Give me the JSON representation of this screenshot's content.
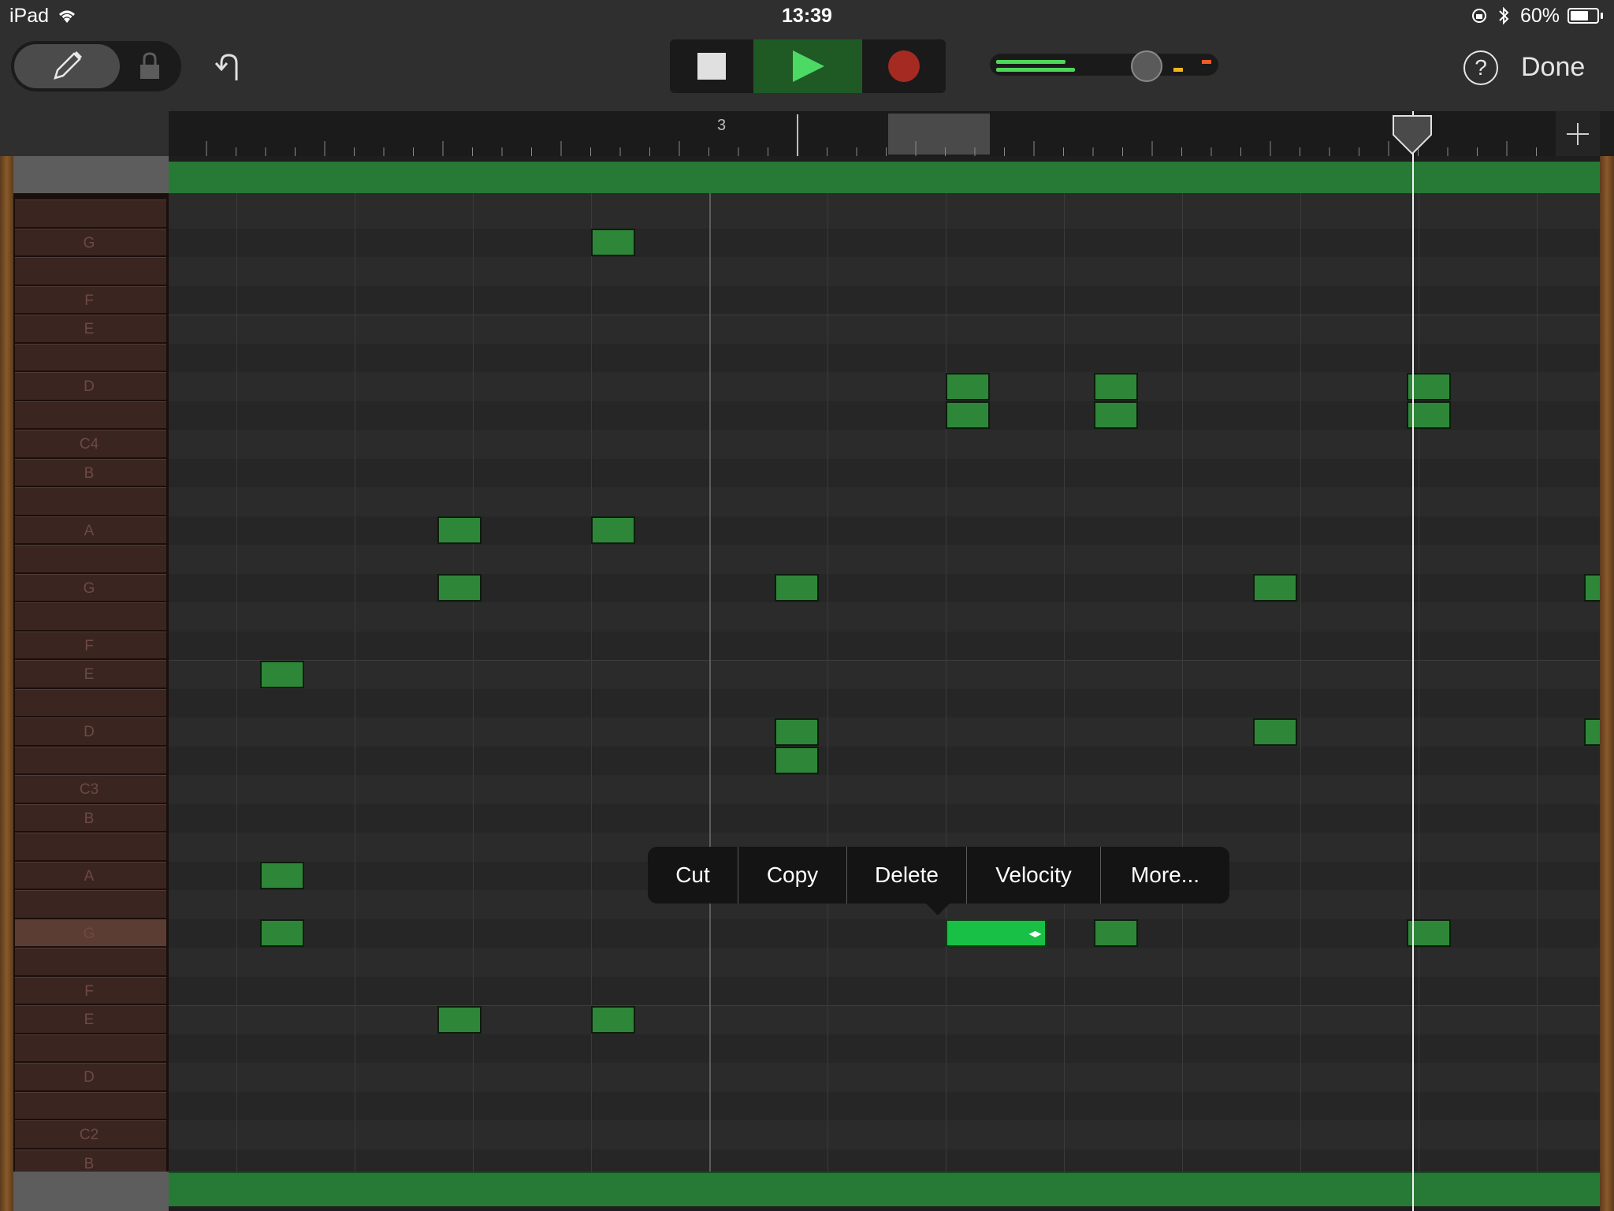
{
  "status_bar": {
    "carrier": "iPad",
    "time": "13:39",
    "battery": "60%"
  },
  "toolbar": {
    "pencil_icon": "pencil-icon",
    "lock_icon": "lock-icon",
    "undo_icon": "undo-icon",
    "stop_icon": "stop-icon",
    "play_icon": "play-icon",
    "record_icon": "record-icon",
    "help_label": "?",
    "done_label": "Done"
  },
  "ruler": {
    "bar_label": "3",
    "add_icon": "plus-icon"
  },
  "keyboard": {
    "labels": [
      {
        "text": "G",
        "row": 1
      },
      {
        "text": "F",
        "row": 3
      },
      {
        "text": "E",
        "row": 4
      },
      {
        "text": "D",
        "row": 6
      },
      {
        "text": "C4",
        "row": 8
      },
      {
        "text": "B",
        "row": 9
      },
      {
        "text": "A",
        "row": 11
      },
      {
        "text": "G",
        "row": 13
      },
      {
        "text": "F",
        "row": 15
      },
      {
        "text": "E",
        "row": 16
      },
      {
        "text": "D",
        "row": 18
      },
      {
        "text": "C3",
        "row": 20
      },
      {
        "text": "B",
        "row": 21
      },
      {
        "text": "A",
        "row": 23
      },
      {
        "text": "G",
        "row": 25
      },
      {
        "text": "F",
        "row": 27
      },
      {
        "text": "E",
        "row": 28
      },
      {
        "text": "D",
        "row": 30
      },
      {
        "text": "C2",
        "row": 32
      },
      {
        "text": "B",
        "row": 33
      }
    ],
    "pressed_row": 25
  },
  "notes": [
    {
      "row": 1,
      "step": 3.0,
      "length": 0.75
    },
    {
      "row": 6,
      "step": 6.0,
      "length": 0.75
    },
    {
      "row": 6,
      "step": 7.25,
      "length": 0.75
    },
    {
      "row": 6,
      "step": 9.9,
      "length": 0.75
    },
    {
      "row": 7,
      "step": 6.0,
      "length": 0.75
    },
    {
      "row": 7,
      "step": 7.25,
      "length": 0.75
    },
    {
      "row": 7,
      "step": 9.9,
      "length": 0.75
    },
    {
      "row": 11,
      "step": 1.7,
      "length": 0.75
    },
    {
      "row": 11,
      "step": 3.0,
      "length": 0.75
    },
    {
      "row": 13,
      "step": 1.7,
      "length": 0.75
    },
    {
      "row": 13,
      "step": 4.55,
      "length": 0.75
    },
    {
      "row": 13,
      "step": 8.6,
      "length": 0.75
    },
    {
      "row": 13,
      "step": 11.4,
      "length": 0.75
    },
    {
      "row": 16,
      "step": 0.2,
      "length": 0.75
    },
    {
      "row": 18,
      "step": 4.55,
      "length": 0.75
    },
    {
      "row": 18,
      "step": 8.6,
      "length": 0.75
    },
    {
      "row": 18,
      "step": 11.4,
      "length": 0.75
    },
    {
      "row": 19,
      "step": 4.55,
      "length": 0.75
    },
    {
      "row": 23,
      "step": 0.2,
      "length": 0.75
    },
    {
      "row": 25,
      "step": 0.2,
      "length": 0.75
    },
    {
      "row": 25,
      "step": 6.0,
      "length": 1.7,
      "selected": true
    },
    {
      "row": 25,
      "step": 7.25,
      "length": 0.75
    },
    {
      "row": 25,
      "step": 9.9,
      "length": 0.75
    },
    {
      "row": 28,
      "step": 1.7,
      "length": 0.75
    },
    {
      "row": 28,
      "step": 3.0,
      "length": 0.75
    }
  ],
  "context_menu": {
    "cut": "Cut",
    "copy": "Copy",
    "delete": "Delete",
    "velocity": "Velocity",
    "more": "More..."
  },
  "colors": {
    "note": "#2e8738",
    "note_selected": "#19c046",
    "region": "#277a35",
    "play_active": "#4cd964",
    "record": "#a52a22"
  }
}
